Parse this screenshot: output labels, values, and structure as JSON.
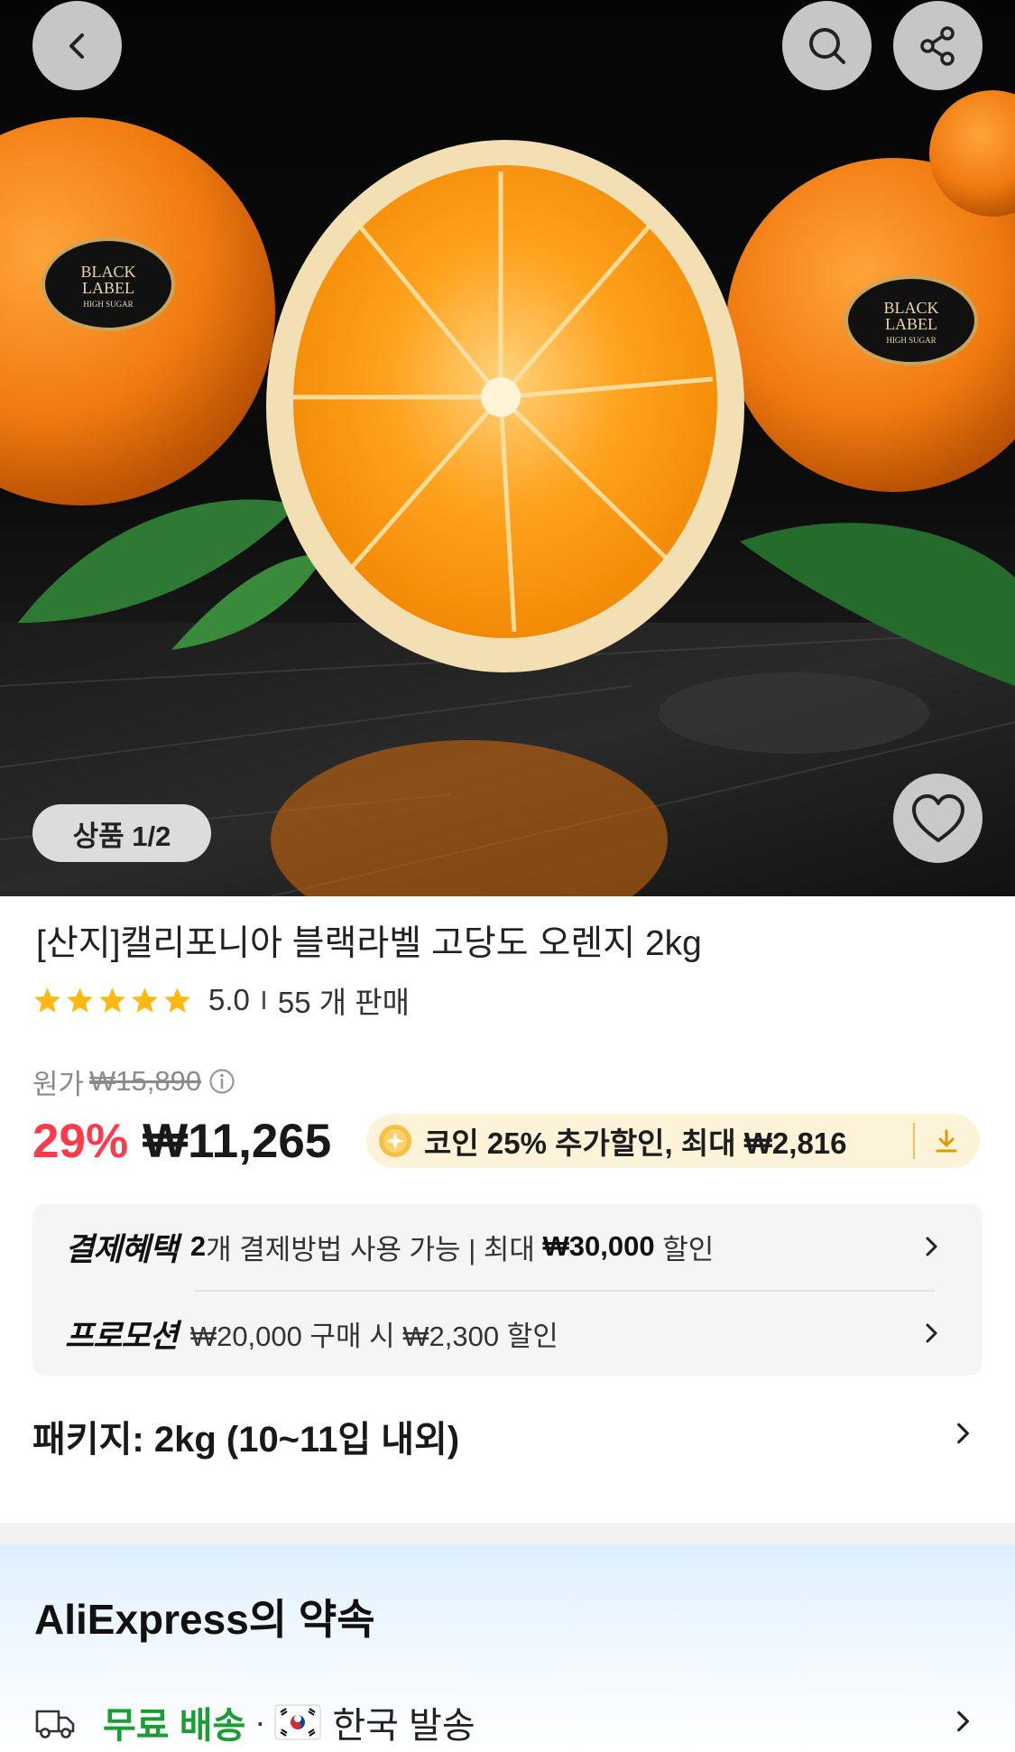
{
  "header": {
    "back_icon": "chevron-left-icon",
    "search_icon": "search-icon",
    "share_icon": "share-icon"
  },
  "gallery": {
    "counter": "상품 1/2",
    "wishlist_icon": "heart-icon",
    "label_text": [
      "BLACK",
      "LABEL",
      "HIGH SUGAR"
    ]
  },
  "product": {
    "title": "[산지]캘리포니아 블랙라벨 고당도 오렌지 2kg",
    "rating": "5.0",
    "rating_value": 5,
    "sold": "55 개 판매",
    "original_label": "원가",
    "original_price": "₩15,890",
    "discount": "29%",
    "price": "₩11,265",
    "coin_promo": "코인 25% 추가할인, 최대 ₩2,816"
  },
  "benefits": {
    "payment_label": "결제혜택",
    "payment_count": "2",
    "payment_text_1": "개 결제방법 사용 가능 | 최대 ",
    "payment_amount": "₩30,000",
    "payment_text_2": " 할인",
    "promotion_label": "프로모션",
    "promotion_text": "₩20,000 구매 시 ₩2,300 할인"
  },
  "package": {
    "label": "패키지: 2kg (10~11입 내외)"
  },
  "promise": {
    "title": "AliExpress의 약속",
    "free_shipping": "무료 배송",
    "separator": "·",
    "ship_from": "한국 발송"
  },
  "colors": {
    "discount_red": "#ff3a4d",
    "star_yellow": "#fdb812",
    "free_shipping_green": "#1a9e34",
    "coin_pill_bg": "#fdf3d9"
  }
}
